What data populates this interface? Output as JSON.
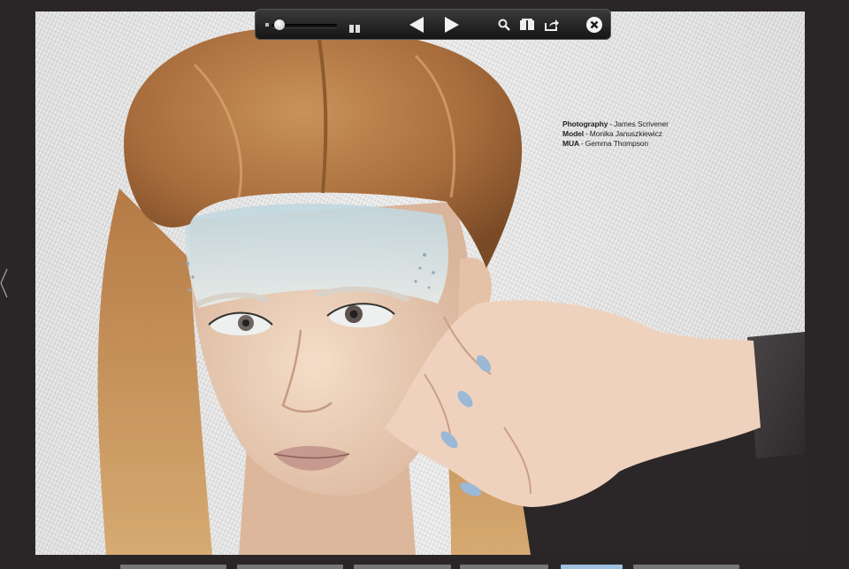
{
  "credits": [
    {
      "role": "Photography",
      "name": "James Scrivener"
    },
    {
      "role": "Model",
      "name": "Monika Januszkiewicz"
    },
    {
      "role": "MUA",
      "name": "Gemma Thompson"
    }
  ],
  "credits_separator": "-",
  "toolbar": {
    "zoom_slider": {
      "level": 0.05
    },
    "icons": {
      "zoom_min": "small-square-icon",
      "view_mode": "two-page-spread-icon",
      "prev": "left-triangle-icon",
      "next": "right-triangle-icon",
      "search": "magnifier-icon",
      "library": "book-icon",
      "share": "share-arrow-icon",
      "close": "close-circle-icon"
    }
  },
  "photo": {
    "description_icon": "portrait-photo"
  },
  "colors": {
    "background": "#2a2627",
    "toolbar": "#1e1e1e",
    "nail_polish": "#9bb8d6"
  }
}
